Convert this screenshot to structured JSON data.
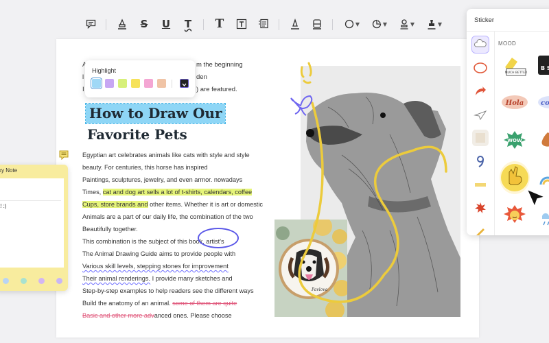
{
  "toolbar": {
    "tools": [
      {
        "name": "comment-tool-icon"
      },
      {
        "name": "highlight-tool-icon"
      },
      {
        "name": "strikethrough-tool-icon",
        "glyph": "S"
      },
      {
        "name": "underline-tool-icon",
        "glyph": "U"
      },
      {
        "name": "squiggly-underline-tool-icon",
        "glyph": "T"
      },
      {
        "name": "text-tool-icon",
        "glyph": "T"
      },
      {
        "name": "textbox-tool-icon",
        "glyph": "T"
      },
      {
        "name": "text-callout-tool-icon"
      },
      {
        "name": "pencil-tool-icon"
      },
      {
        "name": "eraser-tool-icon"
      },
      {
        "name": "shape-tool-icon"
      },
      {
        "name": "sticker-tool-icon"
      },
      {
        "name": "stamp-tool-icon"
      },
      {
        "name": "signature-tool-icon"
      }
    ]
  },
  "highlight_popup": {
    "title": "Highlight",
    "swatches": [
      "#9fd8f6",
      "#c7a7f3",
      "#d7f07a",
      "#f6e25a",
      "#f4a6d3",
      "#f0c4a6"
    ],
    "selected_index": 0
  },
  "intro_lines": [
    {
      "prefix": "A",
      "suffix": "m the beginning"
    },
    {
      "prefix": "l",
      "suffix": "den"
    },
    {
      "prefix": "I",
      "suffix": ") are featured."
    }
  ],
  "title": {
    "line1": "How to Draw Our",
    "line2": "Favorite Pets"
  },
  "body": {
    "l1": "Egyptian art celebrates animals like cats with style and style",
    "l2": "beauty. For centuries, this horse has inspired",
    "l3": "Paintings, sculptures, jewelry, and even armor. nowadays",
    "l4a": "Times, ",
    "l4b": "cat and dog art sells a lot of t-shirts, calendars, coffee",
    "l5a": "Cups, store brands and",
    "l5b": " other items. Whether it is art or domestic",
    "l6": "Animals are a part of our daily life, the combination of the two",
    "l7": "Beautifully together.",
    "l8a": "This combination is the subject of this book. ",
    "l8b": "artist's",
    "l9": "The Animal Drawing Guide aims to provide people with",
    "l10": "Various skill levels, stepping stones for improvement",
    "l11a": "Their animal renderings.",
    "l11b": " I provide many sketches and",
    "l12": "Step-by-step examples to help readers see the different ways",
    "l13a": "Build the anatomy of an animal. ",
    "l13b": "some of them are quite",
    "l14a": "Basic and other more adv",
    "l14b": "anced ones. Please choose"
  },
  "embroidery_text": "Pavlova",
  "sticky_note": {
    "title": "ky Note",
    "line1": "",
    "line2": "t! :)",
    "colors": [
      "#b9d4f4",
      "#a9e2d0",
      "#d3b6f2",
      "#c9b6f5"
    ]
  },
  "sticker_panel": {
    "title": "Sticker",
    "section": "MOOD",
    "categories": [
      "cloud-sticker-icon",
      "circle-doodle-icon",
      "arrow-sticker-icon",
      "paper-plane-icon",
      "paper-note-icon",
      "number-nine-icon",
      "ruler-icon",
      "explosion-sticker-icon",
      "pencil-sticker-icon"
    ],
    "stickers": [
      {
        "name": "highlighter-sticker",
        "label": "MUCH BETTER"
      },
      {
        "name": "speech-sticker",
        "label": "B S"
      },
      {
        "name": "hola-sticker",
        "label": "Hola"
      },
      {
        "name": "cool-sticker",
        "label": "co"
      },
      {
        "name": "wow-sticker",
        "label": "WOW"
      },
      {
        "name": "splat-sticker",
        "label": ""
      },
      {
        "name": "peace-hand-sticker",
        "label": ""
      },
      {
        "name": "rainbow-sticker",
        "label": ""
      },
      {
        "name": "sun-face-sticker",
        "label": ""
      },
      {
        "name": "rain-sticker",
        "label": ""
      }
    ]
  },
  "colors": {
    "highlight_blue": "#8ed6f6",
    "highlight_yellow": "#e6f57a",
    "accent_purple": "#5b58e8",
    "strike_pink": "#e0567a",
    "sticky_yellow": "#f8ec9e",
    "doodle_yellow": "#eccb3c"
  }
}
